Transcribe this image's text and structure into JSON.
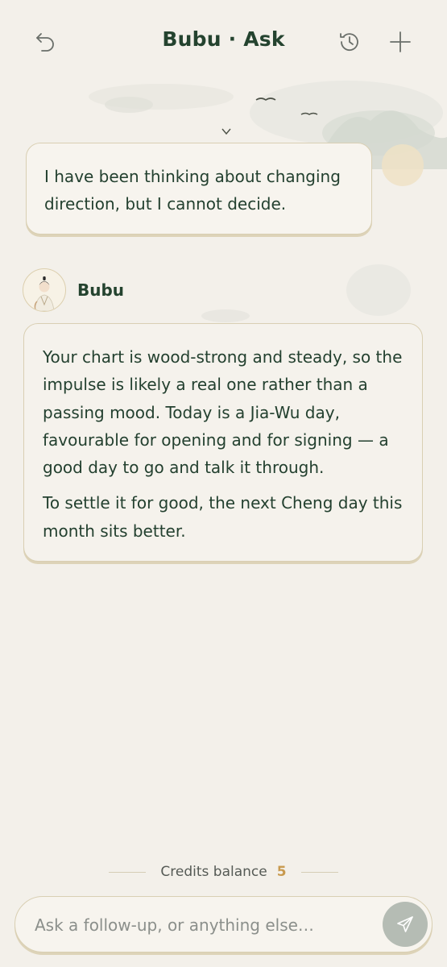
{
  "header": {
    "title": "Bubu · Ask",
    "back_icon": "undo-arrow-icon",
    "history_icon": "history-icon",
    "new_icon": "plus-icon"
  },
  "messages": {
    "user": {
      "text": "I have been thinking about changing direction, but I cannot decide."
    },
    "bot": {
      "name": "Bubu",
      "paragraphs": [
        "Your chart is wood-strong and steady, so the impulse is likely a real one rather than a passing mood. Today is a Jia-Wu day, favourable for opening and for signing — a good day to go and talk it through.",
        "To settle it for good, the next Cheng day this month sits better."
      ]
    }
  },
  "credits": {
    "label": "Credits balance",
    "value": "5"
  },
  "composer": {
    "placeholder": "Ask a follow-up, or anything else…",
    "value": "",
    "send_icon": "paper-plane-icon"
  },
  "colors": {
    "background": "#f3f0ea",
    "primary_text": "#24432f",
    "border_gold": "#d9cfb3",
    "credits_accent": "#c89a4f",
    "send_button": "#b5bcb4"
  }
}
